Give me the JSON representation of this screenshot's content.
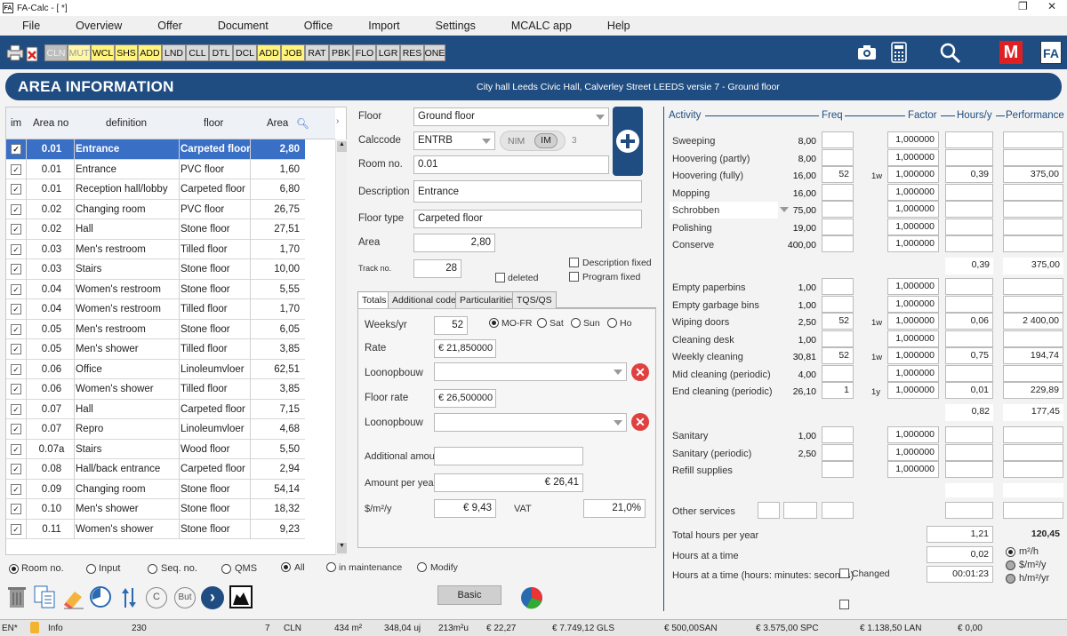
{
  "window": {
    "title": "FA-Calc - [ *]",
    "app_icon": "FA"
  },
  "menu": [
    "File",
    "Overview",
    "Offer",
    "Document",
    "Office",
    "Import",
    "Settings",
    "MCALC app",
    "Help"
  ],
  "toolbar": {
    "buttons": [
      {
        "label": "CLN",
        "style": "dis"
      },
      {
        "label": "MUT",
        "style": "ylight"
      },
      {
        "label": "WCL",
        "style": "y"
      },
      {
        "label": "SHS",
        "style": "y"
      },
      {
        "label": "ADD",
        "style": "y"
      },
      {
        "label": "LND",
        "style": "g"
      },
      {
        "label": "CLL",
        "style": "g"
      },
      {
        "label": "DTL",
        "style": "g"
      },
      {
        "label": "DCL",
        "style": "g"
      },
      {
        "label": "ADD",
        "style": "y"
      },
      {
        "label": "JOB",
        "style": "y"
      },
      {
        "label": "RAT",
        "style": "g"
      },
      {
        "label": "PBK",
        "style": "g"
      },
      {
        "label": "FLO",
        "style": "g"
      },
      {
        "label": "LGR",
        "style": "g"
      },
      {
        "label": "RES",
        "style": "g"
      },
      {
        "label": "ONE",
        "style": "g"
      }
    ],
    "right_logo_m": "M",
    "right_logo_fa": "FA"
  },
  "header": {
    "title": "AREA INFORMATION",
    "subtitle": "City hall Leeds Civic Hall, Calverley Street LEEDS versie 7 - Ground floor"
  },
  "list": {
    "columns": {
      "im": "im",
      "area_no": "Area no",
      "definition": "definition",
      "floor": "floor",
      "area": "Area"
    },
    "rows": [
      {
        "no": "0.01",
        "def": "Entrance",
        "floor": "Carpeted floor",
        "area": "2,80",
        "sel": true
      },
      {
        "no": "0.01",
        "def": "Entrance",
        "floor": "PVC floor",
        "area": "1,60"
      },
      {
        "no": "0.01",
        "def": "Reception hall/lobby",
        "floor": "Carpeted floor",
        "area": "6,80"
      },
      {
        "no": "0.02",
        "def": "Changing room",
        "floor": "PVC floor",
        "area": "26,75"
      },
      {
        "no": "0.02",
        "def": "Hall",
        "floor": "Stone floor",
        "area": "27,51"
      },
      {
        "no": "0.03",
        "def": "Men's restroom",
        "floor": "Tilled floor",
        "area": "1,70"
      },
      {
        "no": "0.03",
        "def": "Stairs",
        "floor": "Stone floor",
        "area": "10,00"
      },
      {
        "no": "0.04",
        "def": "Women's restroom",
        "floor": "Stone floor",
        "area": "5,55"
      },
      {
        "no": "0.04",
        "def": "Women's restroom",
        "floor": "Tilled floor",
        "area": "1,70"
      },
      {
        "no": "0.05",
        "def": "Men's restroom",
        "floor": "Stone floor",
        "area": "6,05"
      },
      {
        "no": "0.05",
        "def": "Men's shower",
        "floor": "Tilled floor",
        "area": "3,85"
      },
      {
        "no": "0.06",
        "def": "Office",
        "floor": "Linoleumvloer",
        "area": "62,51"
      },
      {
        "no": "0.06",
        "def": "Women's shower",
        "floor": "Tilled floor",
        "area": "3,85"
      },
      {
        "no": "0.07",
        "def": "Hall",
        "floor": "Carpeted floor",
        "area": "7,15"
      },
      {
        "no": "0.07",
        "def": "Repro",
        "floor": "Linoleumvloer",
        "area": "4,68"
      },
      {
        "no": "0.07a",
        "def": "Stairs",
        "floor": "Wood floor",
        "area": "5,50"
      },
      {
        "no": "0.08",
        "def": "Hall/back entrance",
        "floor": "Carpeted floor",
        "area": "2,94"
      },
      {
        "no": "0.09",
        "def": "Changing room",
        "floor": "Stone floor",
        "area": "54,14"
      },
      {
        "no": "0.10",
        "def": "Men's shower",
        "floor": "Stone floor",
        "area": "18,32"
      },
      {
        "no": "0.11",
        "def": "Women's shower",
        "floor": "Stone floor",
        "area": "9,23"
      }
    ]
  },
  "sort": {
    "options": [
      "Room no.",
      "Input",
      "Seq. no.",
      "QMS"
    ],
    "filter": [
      "All",
      "in maintenance",
      "Modify"
    ]
  },
  "form": {
    "floor_label": "Floor",
    "floor": "Ground floor",
    "calccode_label": "Calccode",
    "calccode": "ENTRB",
    "nim": "NIM",
    "im": "IM",
    "im_count": "3",
    "room_label": "Room no.",
    "room": "0.01",
    "desc_label": "Description",
    "desc": "Entrance",
    "floortype_label": "Floor type",
    "floortype": "Carpeted floor",
    "area_label": "Area",
    "area": "2,80",
    "track_label": "Track no.",
    "track": "28",
    "deleted": "deleted",
    "desc_fixed": "Description fixed",
    "prog_fixed": "Program fixed"
  },
  "tabs": [
    "Totals",
    "Additional codes",
    "Particularities",
    "TQS/QS"
  ],
  "totals": {
    "weeks_label": "Weeks/yr",
    "weeks": "52",
    "days": [
      "MO-FR",
      "Sat",
      "Sun",
      "Ho"
    ],
    "rate_label": "Rate",
    "rate": "€ 21,850000",
    "loon1_label": "Loonopbouw",
    "floorrate_label": "Floor rate",
    "floorrate": "€ 26,500000",
    "loon2_label": "Loonopbouw",
    "addamt_label": "Additional amour",
    "amtyear_label": "Amount per year",
    "amtyear": "€ 26,41",
    "m2_label": "$/m²/y",
    "m2": "€ 9,43",
    "vat_label": "VAT",
    "vat": "21,0%"
  },
  "basic_button": "Basic",
  "activity": {
    "headers": {
      "activity": "Activity",
      "freq": "Freq",
      "factor": "Factor",
      "hours": "Hours/y",
      "perf": "Performance"
    },
    "rows": [
      {
        "name": "Sweeping",
        "val": "8,00",
        "freq": "",
        "unit": "",
        "factor": "1,000000",
        "hours": "",
        "perf": ""
      },
      {
        "name": "Hoovering (partly)",
        "val": "8,00",
        "freq": "",
        "unit": "",
        "factor": "1,000000",
        "hours": "",
        "perf": ""
      },
      {
        "name": "Hoovering (fully)",
        "val": "16,00",
        "freq": "52",
        "unit": "1w",
        "factor": "1,000000",
        "hours": "0,39",
        "perf": "375,00"
      },
      {
        "name": "Mopping",
        "val": "16,00",
        "freq": "",
        "unit": "",
        "factor": "1,000000",
        "hours": "",
        "perf": ""
      },
      {
        "name": "Schrobben",
        "val": "75,00",
        "freq": "",
        "unit": "",
        "factor": "1,000000",
        "hours": "",
        "perf": ""
      },
      {
        "name": "Polishing",
        "val": "19,00",
        "freq": "",
        "unit": "",
        "factor": "1,000000",
        "hours": "",
        "perf": ""
      },
      {
        "name": "Conserve",
        "val": "400,00",
        "freq": "",
        "unit": "",
        "factor": "1,000000",
        "hours": "",
        "perf": ""
      }
    ],
    "sub1": {
      "hours": "0,39",
      "perf": "375,00"
    },
    "rows2": [
      {
        "name": "Empty paperbins",
        "val": "1,00",
        "freq": "",
        "unit": "",
        "factor": "1,000000",
        "hours": "",
        "perf": ""
      },
      {
        "name": "Empty garbage bins",
        "val": "1,00",
        "freq": "",
        "unit": "",
        "factor": "1,000000",
        "hours": "",
        "perf": ""
      },
      {
        "name": "Wiping doors",
        "val": "2,50",
        "freq": "52",
        "unit": "1w",
        "factor": "1,000000",
        "hours": "0,06",
        "perf": "2 400,00"
      },
      {
        "name": "Cleaning desk",
        "val": "1,00",
        "freq": "",
        "unit": "",
        "factor": "1,000000",
        "hours": "",
        "perf": ""
      },
      {
        "name": "Weekly cleaning",
        "val": "30,81",
        "freq": "52",
        "unit": "1w",
        "factor": "1,000000",
        "hours": "0,75",
        "perf": "194,74"
      },
      {
        "name": "Mid cleaning (periodic)",
        "val": "4,00",
        "freq": "",
        "unit": "",
        "factor": "1,000000",
        "hours": "",
        "perf": ""
      },
      {
        "name": "End cleaning (periodic)",
        "val": "26,10",
        "freq": "1",
        "unit": "1y",
        "factor": "1,000000",
        "hours": "0,01",
        "perf": "229,89"
      }
    ],
    "sub2": {
      "hours": "0,82",
      "perf": "177,45"
    },
    "rows3": [
      {
        "name": "Sanitary",
        "val": "1,00",
        "factor": "1,000000"
      },
      {
        "name": "Sanitary (periodic)",
        "val": "2,50",
        "factor": "1,000000"
      },
      {
        "name": "Refill supplies",
        "val": "",
        "factor": "1,000000"
      }
    ],
    "other": "Other services",
    "total_label": "Total hours per year",
    "total": "1,21",
    "total_perf": "120,45",
    "hat_label": "Hours at a time",
    "hat": "0,02",
    "hms_label": "Hours at a time (hours: minutes: seconds)",
    "hms": "00:01:23",
    "changed": "Changed",
    "units": [
      "m²/h",
      "$/m²/y",
      "h/m²/yr"
    ]
  },
  "status": {
    "lang": "EN*",
    "info": "Info",
    "n230": "230",
    "n7": "7",
    "cln": "CLN",
    "m2": "434 m²",
    "uj": "348,04 uj",
    "m2u": "213m²u",
    "e1": "€ 22,27",
    "e2": "€ 7.749,12",
    "gls": "GLS",
    "e3": "€ 500,00",
    "san": "SAN",
    "e4": "€ 3.575,00",
    "spc": "SPC",
    "e5": "€ 1.138,50",
    "lan": "LAN",
    "e6": "€ 0,00"
  }
}
